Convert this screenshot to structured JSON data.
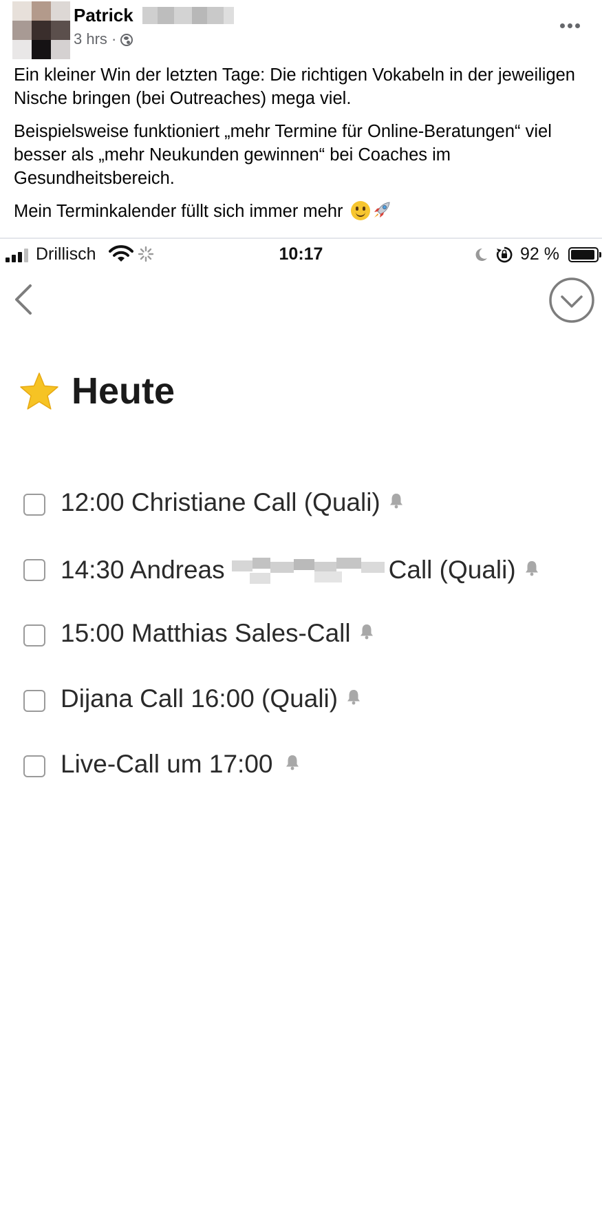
{
  "post": {
    "author": "Patrick",
    "time": "3 hrs ·",
    "icons": {
      "audience": "globe-icon",
      "more": "more-options-icon"
    },
    "paragraphs": [
      "Ein kleiner Win der letzten Tage: Die richtigen Vokabeln in der jeweiligen Nische bringen (bei Outreaches) mega viel.",
      "Beispielsweise funktioniert „mehr Termine für Online-Beratungen“ viel besser als „mehr Neukunden gewinnen“ bei Coaches im Gesundheitsbereich.",
      "Mein Terminkalender füllt sich immer mehr"
    ],
    "trailing_emojis": [
      "slightly-smiling-face",
      "rocket"
    ]
  },
  "screenshot": {
    "status_bar": {
      "carrier": "Drillisch",
      "time": "10:17",
      "battery": "92 %",
      "icons": [
        "signal-icon",
        "wifi-icon",
        "activity-spinner-icon",
        "moon-icon",
        "rotation-lock-icon",
        "battery-icon"
      ]
    },
    "nav": {
      "back_icon": "chevron-left-icon",
      "done_icon": "circle-check-icon"
    },
    "section": {
      "icon": "star-icon",
      "title": "Heute"
    },
    "tasks": [
      {
        "label": "12:00 Christiane Call (Quali)",
        "reminder": true,
        "checked": false
      },
      {
        "label_before": "14:30 Andreas",
        "label_after": "Call (Quali)",
        "redacted": true,
        "reminder": true,
        "checked": false
      },
      {
        "label": "15:00 Matthias Sales-Call",
        "reminder": true,
        "checked": false
      },
      {
        "label": "Dijana Call 16:00 (Quali)",
        "reminder": true,
        "checked": false
      },
      {
        "label": "Live-Call um 17:00",
        "reminder": true,
        "checked": false
      }
    ],
    "colors": {
      "star": "#f6c324",
      "checkbox_border": "#9a9a9a",
      "bell": "#a8a8a8",
      "accent_gray": "#7d7d7d"
    }
  }
}
